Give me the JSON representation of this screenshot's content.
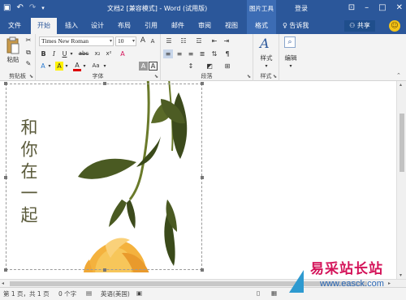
{
  "titlebar": {
    "title": "文档2 [兼容模式] - Word (试用版)",
    "picture_tools": "图片工具",
    "sign_in": "登录"
  },
  "tabs": [
    "文件",
    "开始",
    "插入",
    "设计",
    "布局",
    "引用",
    "邮件",
    "审阅",
    "视图",
    "格式"
  ],
  "active_tab": "开始",
  "tell_me": "告诉我",
  "share": "共享",
  "ribbon": {
    "clipboard": {
      "paste": "粘贴",
      "label": "剪贴板"
    },
    "font": {
      "name": "Times New Roman",
      "size": "10",
      "label": "字体",
      "b": "B",
      "i": "I",
      "u": "U",
      "strike": "abc",
      "sub": "x₂",
      "sup": "x²",
      "grow": "A",
      "shrink": "A",
      "case": "Aa",
      "clear": "A",
      "char": "A",
      "border_a": "A",
      "highlight": "A"
    },
    "paragraph": {
      "label": "段落"
    },
    "styles": {
      "button": "样式",
      "label": "样式"
    },
    "editing": {
      "button": "编辑"
    }
  },
  "document": {
    "vertical_text": "和你在一起"
  },
  "status": {
    "page": "第 1 页，共 1 页",
    "words": "0 个字",
    "language": "英语(美国)"
  },
  "watermark": {
    "title": "易采站长站",
    "url": "www.easck.com"
  },
  "colors": {
    "word_blue": "#2b579a",
    "ribbon_bg": "#f3f3f3",
    "watermark_red": "#d4145a",
    "watermark_blue": "#2a67b5"
  }
}
